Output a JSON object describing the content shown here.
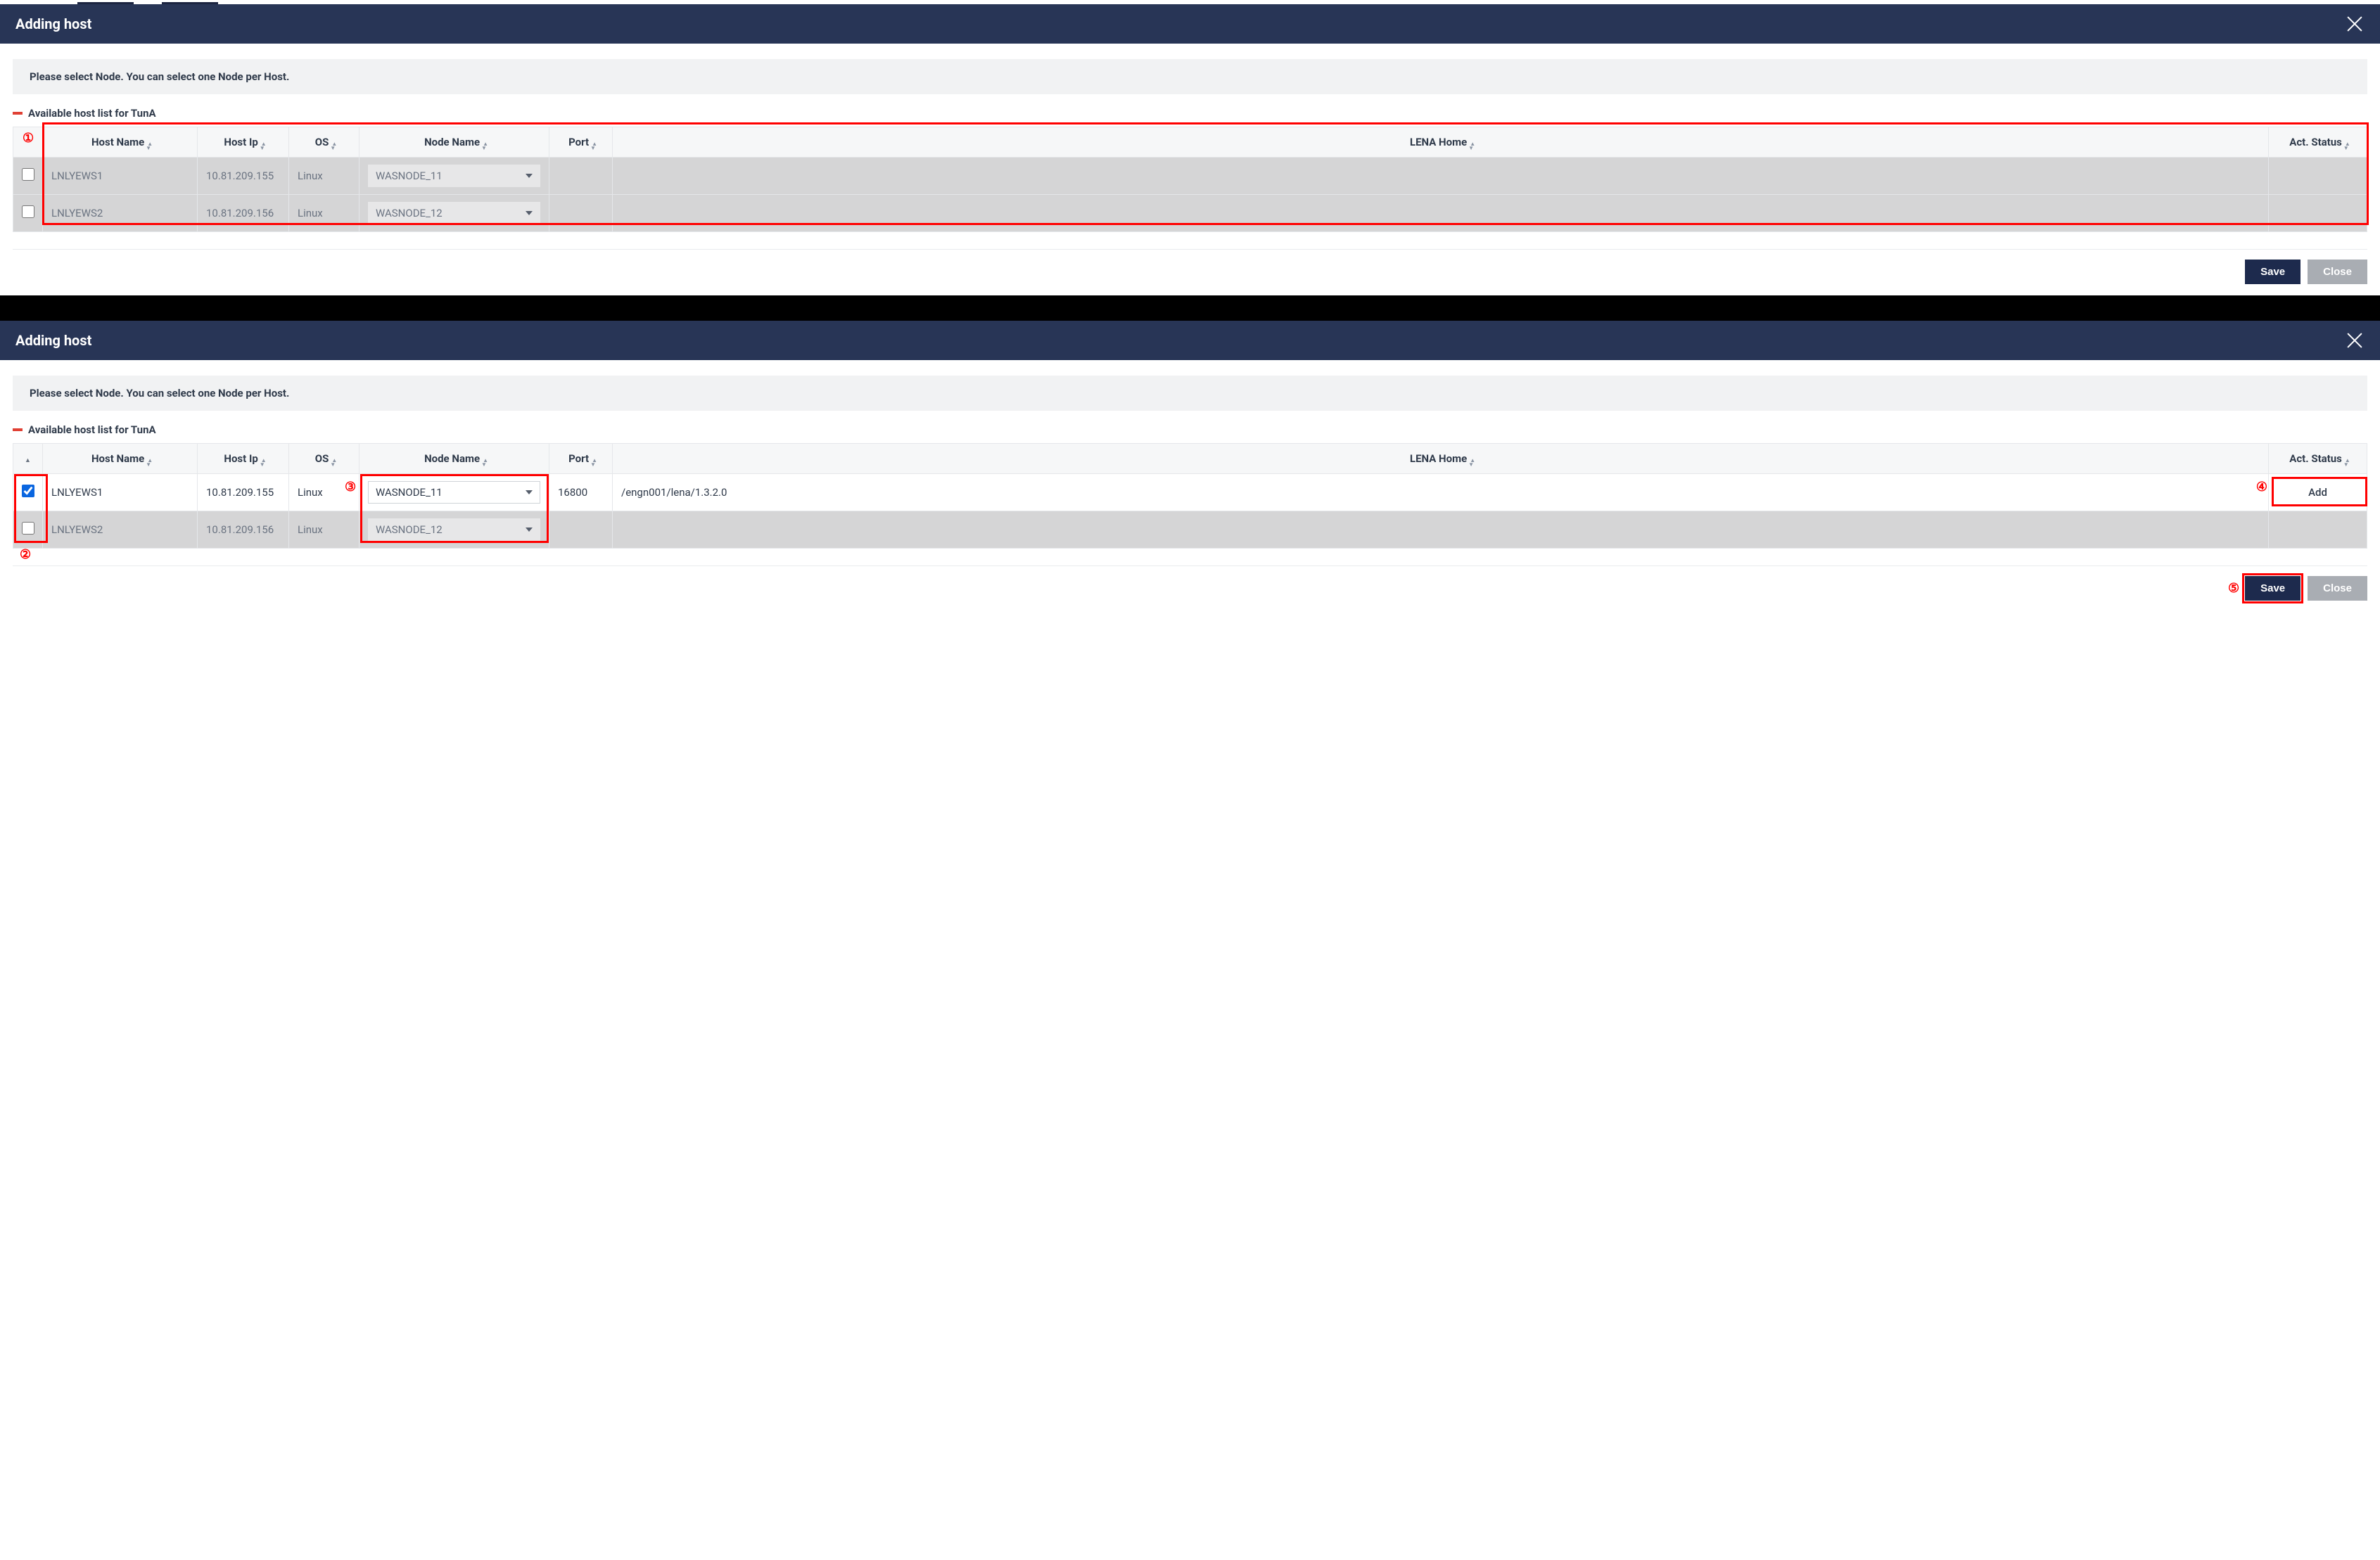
{
  "dialog_title": "Adding host",
  "info_text": "Please select Node. You can select one Node per Host.",
  "section_label": "Available host list for TunA",
  "columns": {
    "host_name": "Host Name",
    "host_ip": "Host Ip",
    "os": "OS",
    "node_name": "Node Name",
    "port": "Port",
    "lena_home": "LENA Home",
    "act_status": "Act. Status"
  },
  "buttons": {
    "save": "Save",
    "close": "Close",
    "add": "Add"
  },
  "panel1": {
    "rows": [
      {
        "host_name": "LNLYEWS1",
        "host_ip": "10.81.209.155",
        "os": "Linux",
        "node_name": "WASNODE_11",
        "port": "",
        "lena_home": "",
        "act_status": ""
      },
      {
        "host_name": "LNLYEWS2",
        "host_ip": "10.81.209.156",
        "os": "Linux",
        "node_name": "WASNODE_12",
        "port": "",
        "lena_home": "",
        "act_status": ""
      }
    ]
  },
  "panel2": {
    "rows": [
      {
        "checked": true,
        "host_name": "LNLYEWS1",
        "host_ip": "10.81.209.155",
        "os": "Linux",
        "node_name": "WASNODE_11",
        "port": "16800",
        "lena_home": "/engn001/lena/1.3.2.0",
        "act_status": "Add"
      },
      {
        "checked": false,
        "host_name": "LNLYEWS2",
        "host_ip": "10.81.209.156",
        "os": "Linux",
        "node_name": "WASNODE_12",
        "port": "",
        "lena_home": "",
        "act_status": ""
      }
    ]
  },
  "callouts": {
    "c1": "①",
    "c2": "②",
    "c3": "③",
    "c4": "④",
    "c5": "⑤"
  }
}
